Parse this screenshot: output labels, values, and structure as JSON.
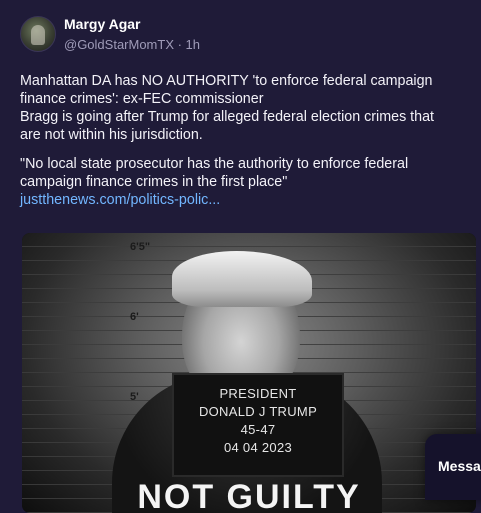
{
  "post": {
    "author_name": "Margy Agar",
    "author_handle": "@GoldStarMomTX · 1h",
    "text_lines_1": [
      "Manhattan DA has NO  AUTHORITY 'to enforce federal campaign",
      "finance crimes': ex-FEC commissioner",
      "Bragg is going after Trump for alleged federal election crimes that",
      "are not within his jurisdiction."
    ],
    "text_lines_2": [
      "\"No local state prosecutor has the authority to enforce federal",
      "campaign finance crimes in the first place\""
    ],
    "link_text": "justthenews.com/politics-polic..."
  },
  "media": {
    "ruler_marks": [
      "6'5\"",
      "6'",
      "5'"
    ],
    "placard": [
      "PRESIDENT",
      "DONALD J TRUMP",
      "45-47",
      "04 04 2023"
    ],
    "overlay_text": "NOT GUILTY"
  },
  "messages_label": "Messa"
}
